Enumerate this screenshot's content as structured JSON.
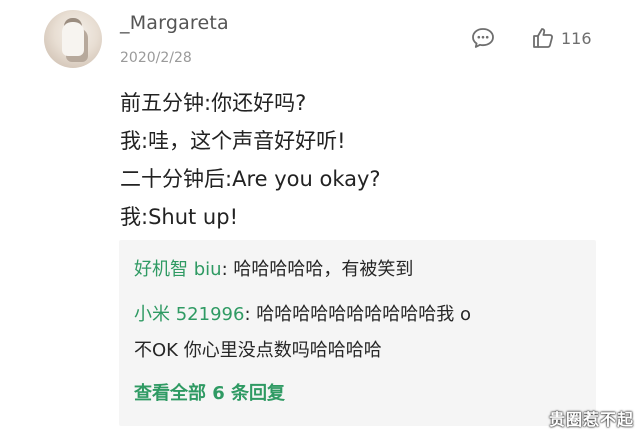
{
  "user": {
    "name": "_Margareta",
    "date": "2020/2/28"
  },
  "actions": {
    "like_count": "116"
  },
  "comment_lines": [
    "前五分钟:你还好吗?",
    "我:哇，这个声音好好听!",
    "二十分钟后:Are you okay?",
    "我:Shut up!"
  ],
  "replies": [
    {
      "author": "好机智 biu",
      "text": ": 哈哈哈哈哈，有被笑到"
    },
    {
      "author": "小米 521996",
      "text": ": 哈哈哈哈哈哈哈哈哈哈我 o",
      "continuation": "不OK 你心里没点数吗哈哈哈哈"
    }
  ],
  "view_all": "查看全部 6 条回复",
  "watermark": "贵圈惹不起",
  "colors": {
    "accent_green": "#2f9a63",
    "reply_bg": "#f5f5f5",
    "icon_gray": "#6e6e6e"
  }
}
